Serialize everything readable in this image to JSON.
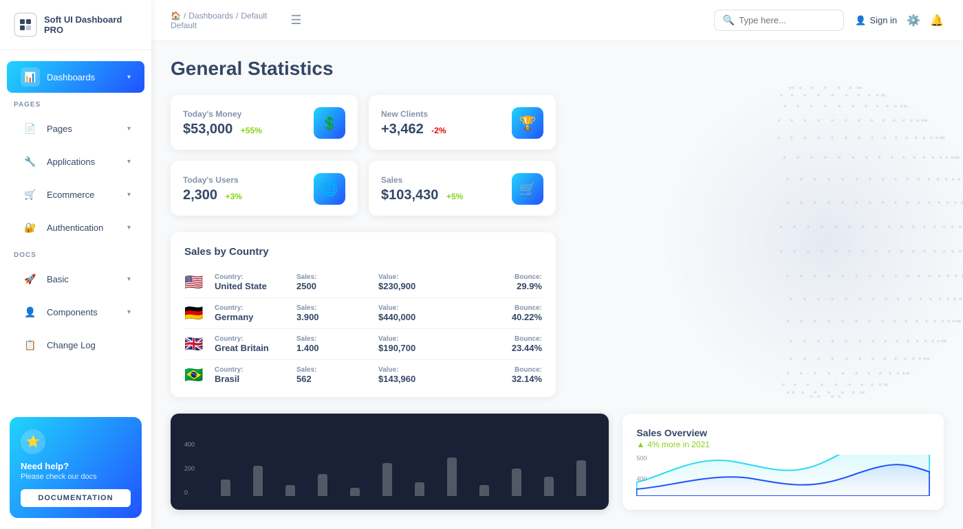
{
  "app": {
    "name": "Soft UI Dashboard PRO"
  },
  "sidebar": {
    "section_pages": "PAGES",
    "section_docs": "DOCS",
    "items_pages": [
      {
        "id": "dashboards",
        "label": "Dashboards",
        "icon": "📊",
        "active": true,
        "has_chevron": true
      },
      {
        "id": "pages",
        "label": "Pages",
        "icon": "📄",
        "active": false,
        "has_chevron": true
      },
      {
        "id": "applications",
        "label": "Applications",
        "icon": "🔧",
        "active": false,
        "has_chevron": true
      },
      {
        "id": "ecommerce",
        "label": "Ecommerce",
        "icon": "🛒",
        "active": false,
        "has_chevron": true
      },
      {
        "id": "authentication",
        "label": "Authentication",
        "icon": "🔐",
        "active": false,
        "has_chevron": true
      }
    ],
    "items_docs": [
      {
        "id": "basic",
        "label": "Basic",
        "icon": "🚀",
        "active": false,
        "has_chevron": true
      },
      {
        "id": "components",
        "label": "Components",
        "icon": "👤",
        "active": false,
        "has_chevron": true
      },
      {
        "id": "changelog",
        "label": "Change Log",
        "icon": "📋",
        "active": false,
        "has_chevron": false
      }
    ],
    "help": {
      "title": "Need help?",
      "subtitle": "Please check our docs",
      "button_label": "DOCUMENTATION"
    }
  },
  "topbar": {
    "breadcrumb": {
      "home": "🏠",
      "sep1": "/",
      "dashboards": "Dashboards",
      "sep2": "/",
      "current": "Default",
      "page_title": "Default"
    },
    "search_placeholder": "Type here...",
    "signin_label": "Sign in"
  },
  "main": {
    "page_title": "General Statistics",
    "stats": [
      {
        "label": "Today's Money",
        "value": "$53,000",
        "badge": "+55%",
        "badge_type": "green",
        "icon": "💲"
      },
      {
        "label": "New Clients",
        "value": "+3,462",
        "badge": "-2%",
        "badge_type": "red",
        "icon": "🏆"
      },
      {
        "label": "Today's Users",
        "value": "2,300",
        "badge": "+3%",
        "badge_type": "green",
        "icon": "🌐"
      },
      {
        "label": "Sales",
        "value": "$103,430",
        "badge": "+5%",
        "badge_type": "green",
        "icon": "🛒"
      }
    ],
    "sales_by_country": {
      "title": "Sales by Country",
      "columns": [
        "Country:",
        "Sales:",
        "Value:",
        "Bounce:"
      ],
      "rows": [
        {
          "flag": "🇺🇸",
          "country": "United State",
          "sales": "2500",
          "value": "$230,900",
          "bounce": "29.9%"
        },
        {
          "flag": "🇩🇪",
          "country": "Germany",
          "sales": "3.900",
          "value": "$440,000",
          "bounce": "40.22%"
        },
        {
          "flag": "🇬🇧",
          "country": "Great Britain",
          "sales": "1.400",
          "value": "$190,700",
          "bounce": "23.44%"
        },
        {
          "flag": "🇧🇷",
          "country": "Brasil",
          "sales": "562",
          "value": "$143,960",
          "bounce": "32.14%"
        }
      ]
    },
    "bar_chart": {
      "y_labels": [
        "400",
        "200",
        "0"
      ],
      "bars": [
        {
          "height": 30,
          "label": ""
        },
        {
          "height": 55,
          "label": ""
        },
        {
          "height": 20,
          "label": ""
        },
        {
          "height": 40,
          "label": ""
        },
        {
          "height": 15,
          "label": ""
        },
        {
          "height": 60,
          "label": ""
        },
        {
          "height": 25,
          "label": ""
        },
        {
          "height": 70,
          "label": ""
        },
        {
          "height": 20,
          "label": ""
        },
        {
          "height": 50,
          "label": ""
        },
        {
          "height": 35,
          "label": ""
        },
        {
          "height": 65,
          "label": ""
        }
      ]
    },
    "sales_overview": {
      "title": "Sales Overview",
      "trend": "4% more in 2021",
      "y_labels": [
        "500",
        "400"
      ]
    }
  }
}
